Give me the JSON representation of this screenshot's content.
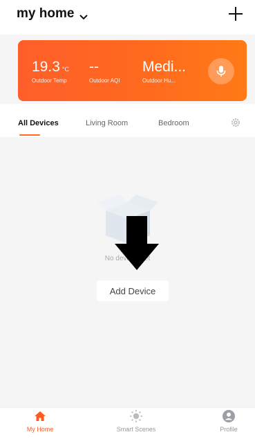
{
  "header": {
    "title": "my home"
  },
  "weather": {
    "temp_value": "19.3",
    "temp_unit": "°C",
    "temp_label": "Outdoor Temp",
    "aqi_value": "--",
    "aqi_label": "Outdoor AQI",
    "humidity_value": "Medi...",
    "humidity_label": "Outdoor Hu..."
  },
  "tabs": [
    {
      "label": "All Devices",
      "active": true
    },
    {
      "label": "Living Room",
      "active": false
    },
    {
      "label": "Bedroom",
      "active": false
    }
  ],
  "empty_state": {
    "message": "No devices yet",
    "add_button_label": "Add Device"
  },
  "bottom_nav": [
    {
      "label": "My Home",
      "icon": "home-icon",
      "active": true
    },
    {
      "label": "Smart Scenes",
      "icon": "sun-icon",
      "active": false
    },
    {
      "label": "Profile",
      "icon": "profile-icon",
      "active": false
    }
  ],
  "colors": {
    "accent": "#ff6a1e",
    "background": "#f5f5f5"
  }
}
